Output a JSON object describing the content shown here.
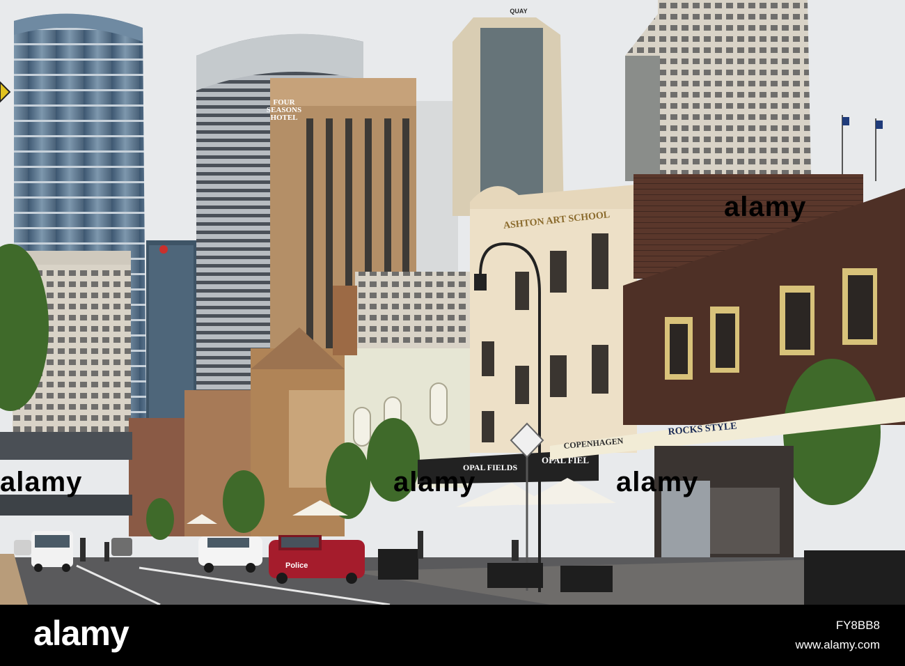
{
  "photo": {
    "signs": {
      "four_seasons": [
        "FOUR",
        "SEASONS",
        "HOTEL"
      ],
      "quay": "QUAY",
      "art_school": "ASHTON ART SCHOOL",
      "rocks_style": "ROCKS STYLE",
      "copenhagen": "COPENHAGEN",
      "opal_fields_1": "OPAL FIELDS",
      "opal_fields_2": "OPAL FIEL",
      "police": "Police"
    },
    "watermark": "alamy"
  },
  "footer": {
    "logo": "alamy",
    "image_id": "FY8BB8",
    "site": "www.alamy.com"
  },
  "colors": {
    "sky": "#e8eaec",
    "footer": "#000000",
    "road": "#5a5a5c",
    "sandstone": "#c9a57a",
    "brick": "#4e3026"
  }
}
